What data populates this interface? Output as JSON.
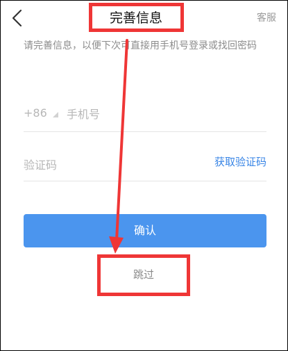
{
  "header": {
    "title": "完善信息",
    "service_label": "客服",
    "back_icon": "chevron-left-icon"
  },
  "description": "请完善信息，以便下次可直接用手机号登录或找回密码",
  "phone": {
    "country_code": "+86",
    "placeholder": "手机号",
    "value": ""
  },
  "verification": {
    "placeholder": "验证码",
    "value": "",
    "get_code_label": "获取验证码"
  },
  "confirm_label": "确认",
  "skip_label": "跳过",
  "colors": {
    "accent": "#4b95ee",
    "link": "#3a86e6",
    "annotation": "#ef3636"
  }
}
